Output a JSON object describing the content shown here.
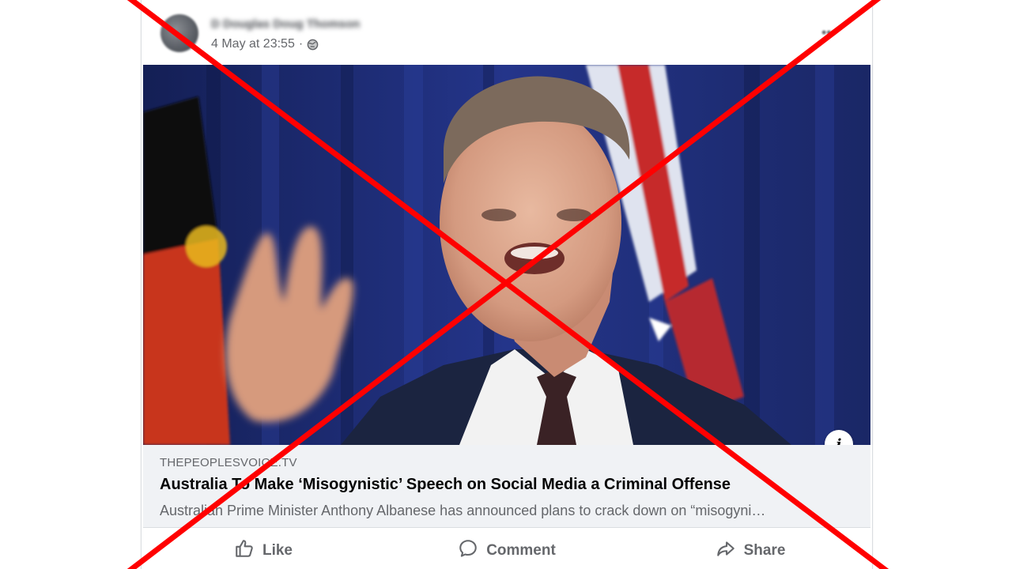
{
  "post": {
    "author_name": "D Douglas Doug Thomson",
    "timestamp": "4 May at 23:55",
    "separator": "·",
    "privacy_icon": "globe-icon",
    "more_icon": "more-options-icon"
  },
  "link_preview": {
    "domain": "THEPEOPLESVOICE.TV",
    "title": "Australia To Make ‘Misogynistic’ Speech on Social Media a Criminal Offense",
    "description": "Australian Prime Minister Anthony Albanese has announced plans to crack down on “misogyni…",
    "info_label": "i"
  },
  "actions": {
    "like_label": "Like",
    "comment_label": "Comment",
    "share_label": "Share"
  },
  "overlay": {
    "cross_color": "#ff0000",
    "meaning": "false-claim-cross"
  },
  "colors": {
    "muted_text": "#65676b",
    "title_text": "#050505",
    "preview_bg": "#f0f2f5",
    "flag_blue": "#1d2a6b"
  }
}
